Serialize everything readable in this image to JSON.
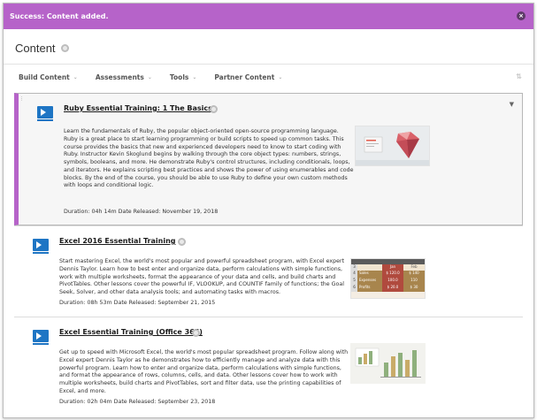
{
  "banner": {
    "message": "Success: Content added.",
    "close_glyph": "×"
  },
  "page": {
    "title": "Content"
  },
  "action_bar": {
    "items": [
      {
        "label": "Build Content"
      },
      {
        "label": "Assessments"
      },
      {
        "label": "Tools"
      },
      {
        "label": "Partner Content"
      }
    ],
    "chevron": "⌄",
    "sort_glyph": "⇅"
  },
  "items": [
    {
      "title": "Ruby Essential Training: 1 The Basics",
      "description": "Learn the fundamentals of Ruby, the popular object-oriented open-source programming language. Ruby is a great place to start learning programming or build scripts to speed up common tasks. This course provides the basics that new and experienced developers need to know to start coding with Ruby. Instructor Kevin Skoglund begins by walking through the core object types: numbers, strings, symbols, booleans, and more. He demonstrate Ruby's control structures, including conditionals, loops, and iterators. He explains scripting best practices and shows the power of using enumerables and code blocks. By the end of the course, you should be able to use Ruby to define your own custom methods with loops and conditional logic.",
      "meta": "Duration: 04h 14m  Date Released: November 19, 2018",
      "selected": true
    },
    {
      "title": "Excel 2016 Essential Training",
      "description": "Start mastering Excel, the world's most popular and powerful spreadsheet program, with Excel expert Dennis Taylor. Learn how to best enter and organize data, perform calculations with simple functions, work with multiple worksheets, format the appearance of your data and cells, and build charts and PivotTables. Other lessons cover the powerful IF, VLOOKUP, and COUNTIF family of functions; the Goal Seek, Solver, and other data analysis tools; and automating tasks with macros.",
      "meta": "Duration: 08h 53m  Date Released: September 21, 2015",
      "spreadsheet": {
        "col_labels": [
          "",
          "Jan",
          "Feb"
        ],
        "rows": [
          {
            "num": "4",
            "label": "Sales",
            "v1": "$ 120.0",
            "v2": "$ 140"
          },
          {
            "num": "5",
            "label": "Expenses",
            "v1": "100.0",
            "v2": "110"
          },
          {
            "num": "6",
            "label": "Profits",
            "v1": "$ 20.0",
            "v2": "$ 30"
          }
        ]
      }
    },
    {
      "title": "Excel Essential Training (Office 365)",
      "description": "Get up to speed with Microsoft Excel, the world's most popular spreadsheet program. Follow along with Excel expert Dennis Taylor as he demonstrates how to efficiently manage and analyze data with this powerful program. Learn how to enter and organize data, perform calculations with simple functions, and format the appearance of rows, columns, cells, and data. Other lessons cover how to work with multiple worksheets, build charts and PivotTables, sort and filter data, use the printing capabilities of Excel, and more.",
      "meta": "Duration: 02h 04m  Date Released: September 23, 2018"
    }
  ],
  "colors": {
    "accent": "#b663c9",
    "icon_blue": "#1e75c4"
  }
}
